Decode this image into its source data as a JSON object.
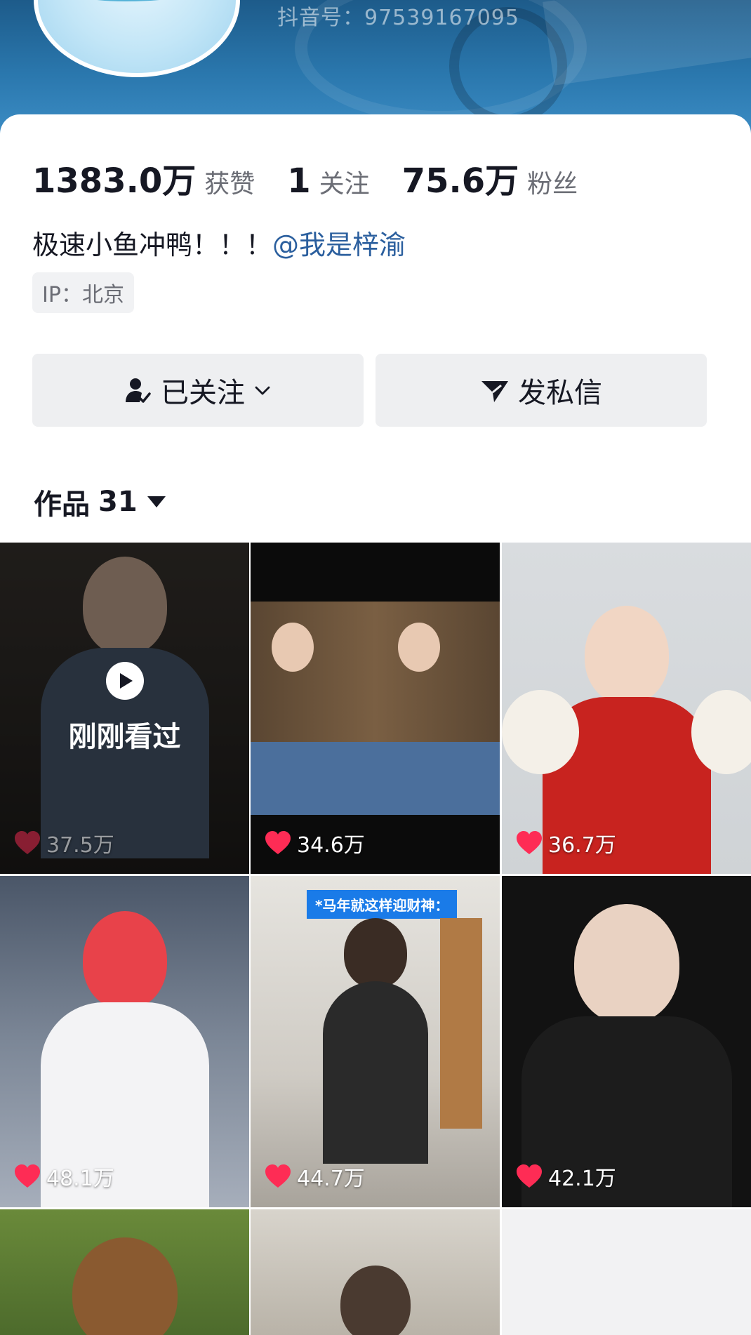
{
  "profile": {
    "douyin_id": "抖音号：97539167095",
    "stats": [
      {
        "num": "1383.0万",
        "label": "获赞"
      },
      {
        "num": "1",
        "label": "关注"
      },
      {
        "num": "75.6万",
        "label": "粉丝"
      }
    ],
    "bio_text": "极速小鱼冲鸭！！！",
    "bio_mention": "@我是梓渝",
    "ip_label": "IP：北京"
  },
  "actions": {
    "follow_label": "已关注",
    "message_label": "发私信"
  },
  "works": {
    "label": "作品",
    "count": "31",
    "recently_viewed_label": "刚刚看过",
    "caption_tag": "*马年就这样迎财神：",
    "items": [
      {
        "likes": "37.5万"
      },
      {
        "likes": "34.6万"
      },
      {
        "likes": "36.7万"
      },
      {
        "likes": "48.1万"
      },
      {
        "likes": "44.7万"
      },
      {
        "likes": "42.1万"
      }
    ]
  },
  "colors": {
    "banner": "#2a77ad",
    "mention": "#2b5f9e",
    "heart": "#fe2c55"
  }
}
